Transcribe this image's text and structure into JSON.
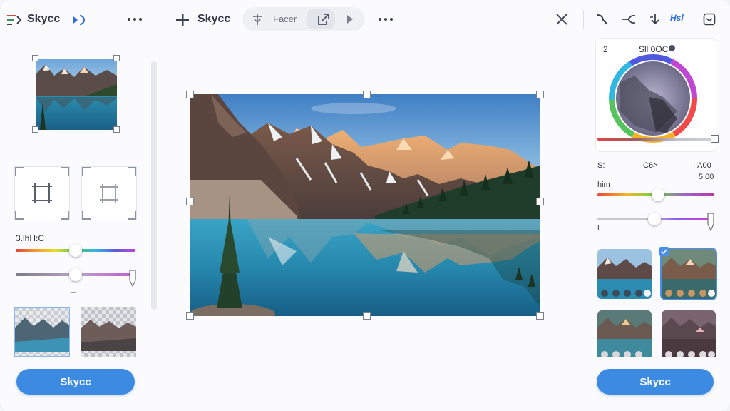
{
  "toolbar": {
    "brand_label": "Skycc",
    "add_label": "Skycc",
    "pill_label": "Facer",
    "hsl_label": "Hsl",
    "icons": [
      "brand-icon",
      "redo-icon",
      "more-icon",
      "add-icon",
      "drop-icon",
      "share-icon",
      "play-icon",
      "close-icon",
      "curve-icon",
      "fork-icon",
      "down-arrow-icon",
      "panel-icon"
    ]
  },
  "left_panel": {
    "slider_label": "3.lhH:C",
    "slider1_value": 0.5,
    "slider2_value": 0.5,
    "apply_label": "Skycc"
  },
  "right_panel": {
    "color_header_left": "2",
    "color_header_right": "Sll 0OC",
    "stat_s": "S:",
    "stat_mid": "C6>",
    "stat_right": "IIA00",
    "stat_right_sub": "5 00",
    "hue_label": "him",
    "tick_label": "I",
    "slider1_value": 0.52,
    "slider2_value": 0.5,
    "apply_label": "Skycc"
  },
  "colors": {
    "accent": "#3d8ae3",
    "selection": "#4a8fe7"
  }
}
